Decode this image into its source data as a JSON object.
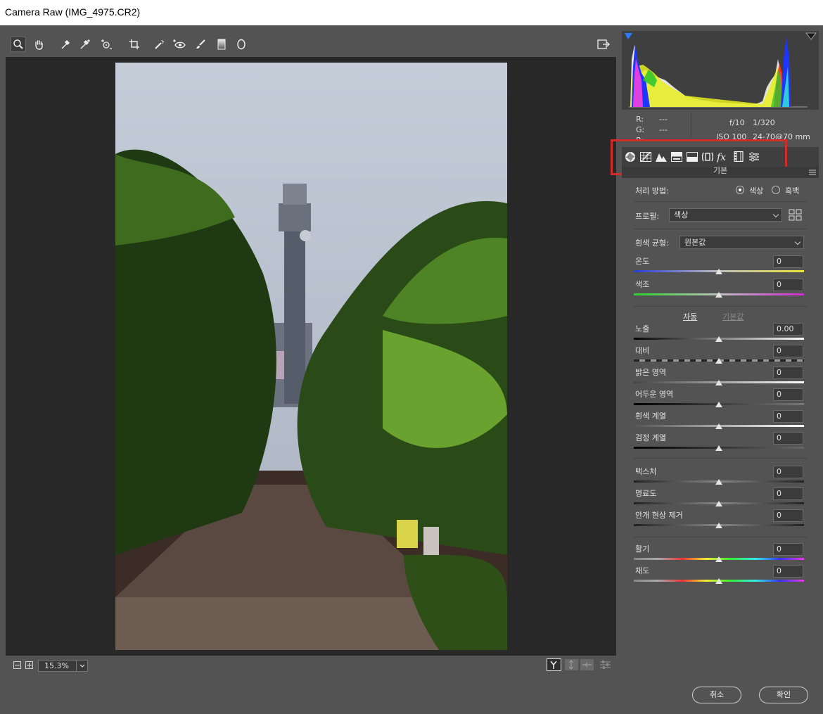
{
  "window": {
    "title": "Camera Raw (IMG_4975.CR2)"
  },
  "status": {
    "zoom": "15.3%"
  },
  "info": {
    "r_label": "R:",
    "g_label": "G:",
    "b_label": "B:",
    "r_value": "---",
    "g_value": "---",
    "aperture": "f/10",
    "shutter": "1/320",
    "iso": "ISO 100",
    "lens": "24-70@70 mm"
  },
  "panel": {
    "title": "기본"
  },
  "basic": {
    "treatment_label": "처리 방법:",
    "treatment_color": "색상",
    "treatment_bw": "흑백",
    "profile_label": "프로필:",
    "profile_value": "색상",
    "wb_label": "흰색 균형:",
    "wb_value": "원본값",
    "auto_label": "자동",
    "default_label": "기본값",
    "sliders": [
      {
        "label": "온도",
        "value": "0"
      },
      {
        "label": "색조",
        "value": "0"
      },
      {
        "label": "노출",
        "value": "0.00"
      },
      {
        "label": "대비",
        "value": "0"
      },
      {
        "label": "밝은 영역",
        "value": "0"
      },
      {
        "label": "어두운 영역",
        "value": "0"
      },
      {
        "label": "흰색 계열",
        "value": "0"
      },
      {
        "label": "검정 계열",
        "value": "0"
      },
      {
        "label": "텍스처",
        "value": "0"
      },
      {
        "label": "명료도",
        "value": "0"
      },
      {
        "label": "안개 현상 제거",
        "value": "0"
      },
      {
        "label": "활기",
        "value": "0"
      },
      {
        "label": "채도",
        "value": "0"
      }
    ]
  },
  "dialog": {
    "cancel": "취소",
    "ok": "확인"
  },
  "colors": {
    "highlight_box": "#d32a2a"
  },
  "icons": {
    "toolbar": [
      "zoom-icon",
      "hand-icon",
      "white-balance-icon",
      "color-sampler-icon",
      "targeted-adjustment-icon",
      "crop-icon",
      "spot-removal-icon",
      "red-eye-icon",
      "adjustment-brush-icon",
      "graduated-filter-icon",
      "radial-filter-icon",
      "open-preferences-icon"
    ],
    "tabs": [
      "basic-tab-icon",
      "tone-curve-tab-icon",
      "detail-tab-icon",
      "hsl-tab-icon",
      "split-toning-tab-icon",
      "lens-corrections-tab-icon",
      "effects-tab-icon",
      "calibration-tab-icon",
      "presets-tab-icon"
    ]
  }
}
